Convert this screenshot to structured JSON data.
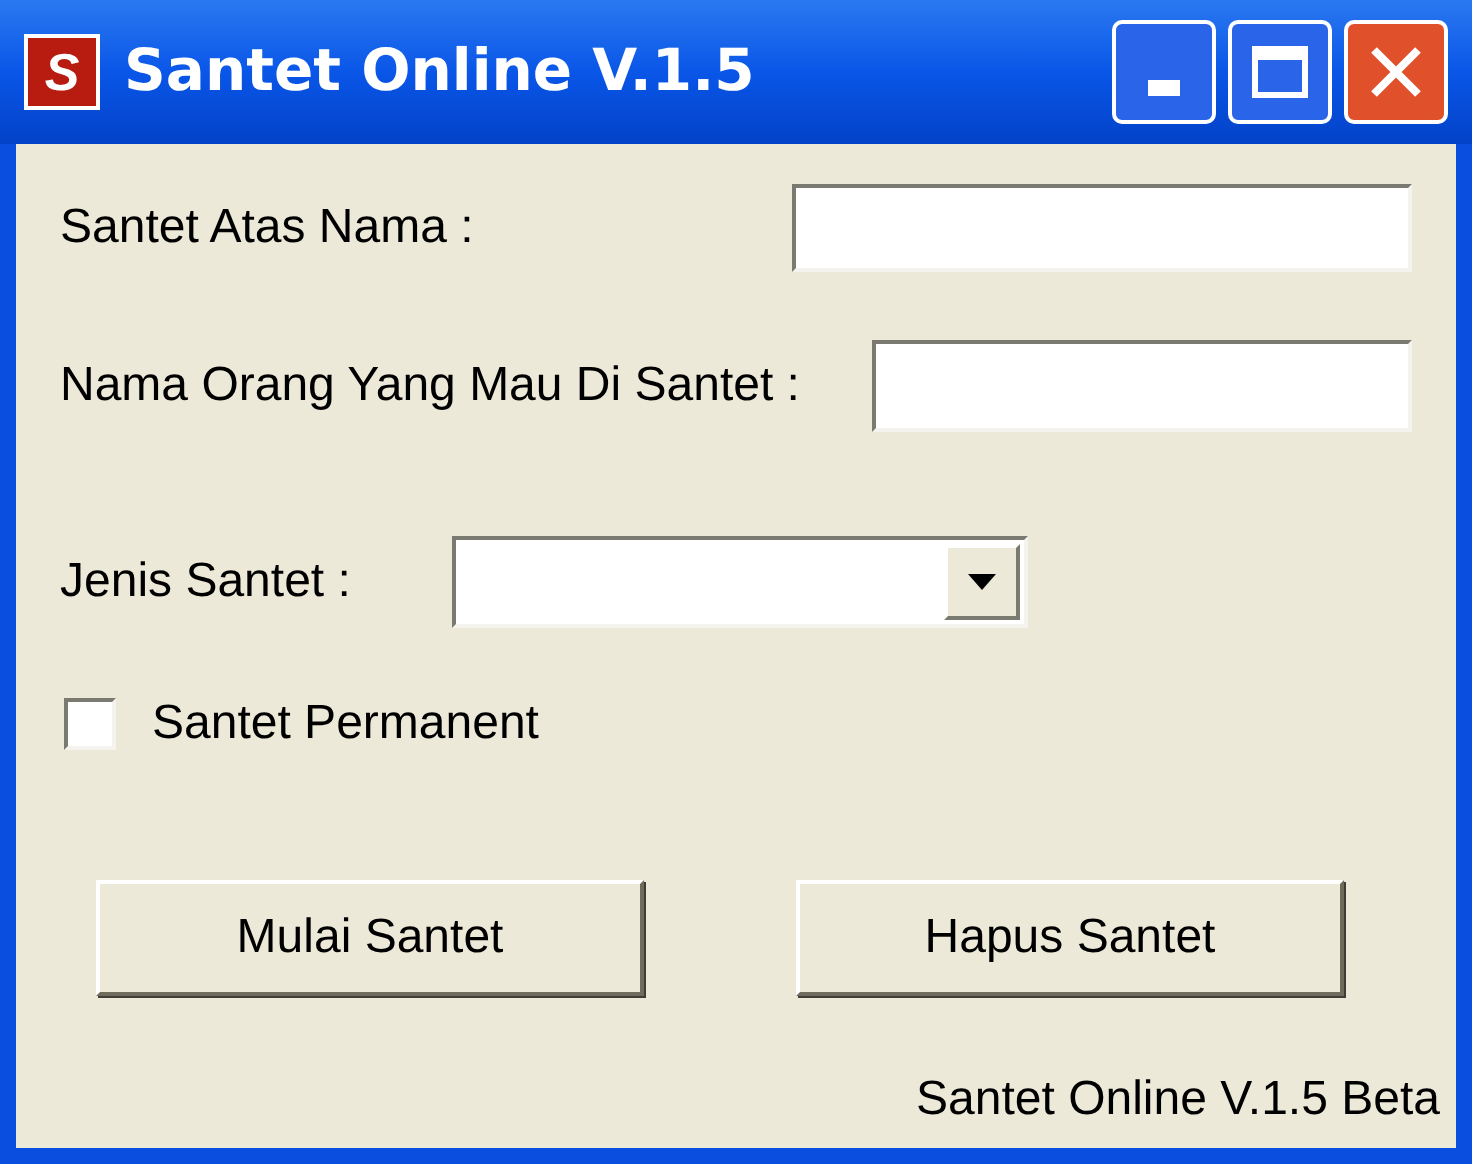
{
  "window": {
    "title": "Santet Online V.1.5",
    "icon_letter": "S"
  },
  "fields": [
    {
      "label": "Santet Atas Nama :"
    },
    {
      "label": "Nama Orang Yang Mau Di Santet :"
    }
  ],
  "dropdown": {
    "label": "Jenis Santet :"
  },
  "checkbox": {
    "label": "Santet Permanent",
    "checked": false
  },
  "buttons": [
    "Mulai Santet",
    "Hapus Santet"
  ],
  "footer": "Santet Online V.1.5 Beta"
}
